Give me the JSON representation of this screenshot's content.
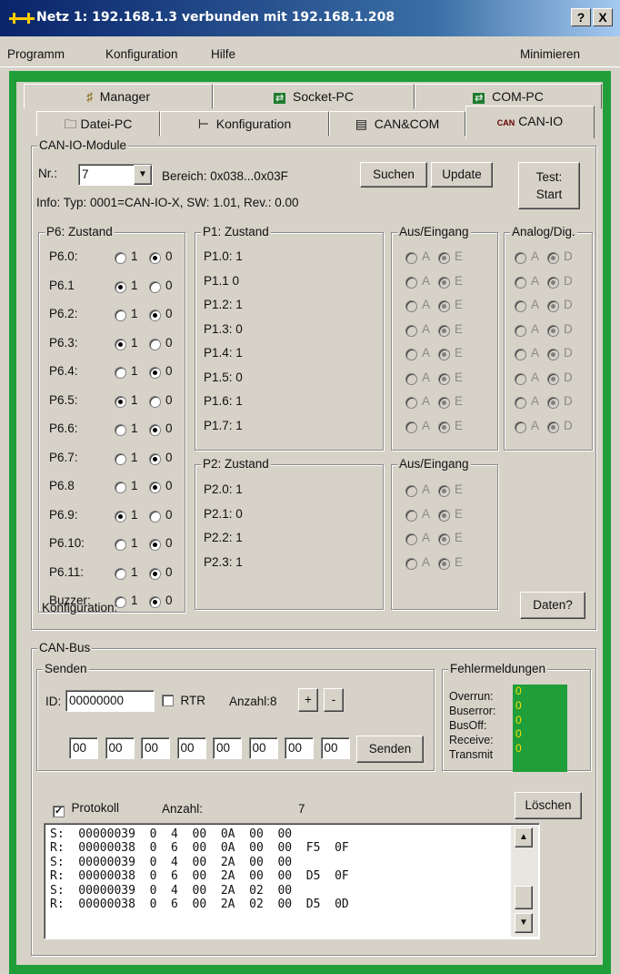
{
  "window": {
    "title": "Netz 1: 192.168.1.3  verbunden mit 192.168.1.208",
    "help_btn": "?",
    "close_btn": "X"
  },
  "menu": {
    "programm": "Programm",
    "konfiguration": "Konfiguration",
    "hilfe": "Hilfe",
    "minimieren": "Minimieren"
  },
  "tabs_row1": [
    "Manager",
    "Socket-PC",
    "COM-PC"
  ],
  "tabs_row2": [
    "Datei-PC",
    "Konfiguration",
    "CAN&COM",
    "CAN-IO"
  ],
  "tab_can_badge": "CAN",
  "module": {
    "group": "CAN-IO-Module",
    "nr_label": "Nr.:",
    "nr_value": "7",
    "bereich": "Bereich: 0x038...0x03F",
    "suchen": "Suchen",
    "update": "Update",
    "test1": "Test:",
    "test2": "Start",
    "info": "Info:  Typ: 0001=CAN-IO-X, SW: 1.01, Rev.: 0.00"
  },
  "p6": {
    "title": "P6: Zustand",
    "one": "1",
    "zero": "0",
    "rows": [
      {
        "name": "P6.0:",
        "state": 0
      },
      {
        "name": "P6.1",
        "state": 1
      },
      {
        "name": "P6.2:",
        "state": 0
      },
      {
        "name": "P6.3:",
        "state": 1
      },
      {
        "name": "P6.4:",
        "state": 0
      },
      {
        "name": "P6.5:",
        "state": 1
      },
      {
        "name": "P6.6:",
        "state": 0
      },
      {
        "name": "P6.7:",
        "state": 0
      },
      {
        "name": "P6.8",
        "state": 0
      },
      {
        "name": "P6.9:",
        "state": 1
      },
      {
        "name": "P6.10:",
        "state": 0
      },
      {
        "name": "P6.11:",
        "state": 0
      },
      {
        "name": "Buzzer:",
        "state": 0
      }
    ]
  },
  "p1": {
    "title": "P1: Zustand",
    "rows": [
      "P1.0:  1",
      "P1.1   0",
      "P1.2:  1",
      "P1.3:  0",
      "P1.4:  1",
      "P1.5:  0",
      "P1.6:  1",
      "P1.7:  1"
    ]
  },
  "p2": {
    "title": "P2: Zustand",
    "rows": [
      "P2.0:  1",
      "P2.1:  0",
      "P2.2:  1",
      "P2.3:  1"
    ]
  },
  "ausein": {
    "title": "Aus/Eingang",
    "a": "A",
    "e": "E"
  },
  "analog": {
    "title": "Analog/Dig.",
    "a": "A",
    "d": "D"
  },
  "konfig": {
    "label": "Konfiguration:",
    "daten": "Daten?"
  },
  "canbus": {
    "group": "CAN-Bus",
    "senden_group": "Senden",
    "id_label": "ID:",
    "id_value": "00000000",
    "rtr": "RTR",
    "anzahl": "Anzahl:8",
    "plus": "+",
    "minus": "-",
    "bytes": [
      "00",
      "00",
      "00",
      "00",
      "00",
      "00",
      "00",
      "00"
    ],
    "senden_btn": "Senden"
  },
  "fehler": {
    "title": "Fehlermeldungen",
    "labels": [
      "Overrun:",
      "Buserror:",
      "BusOff:",
      "Receive:",
      "Transmit"
    ],
    "values": [
      "0",
      "0",
      "0",
      "0",
      "0"
    ]
  },
  "protokoll": {
    "label": "Protokoll",
    "checked": "✓",
    "anzahl_label": "Anzahl:",
    "anzahl_value": "7",
    "loeschen": "Löschen",
    "lines": [
      "S:  00000039  0  4  00  0A  00  00",
      "R:  00000038  0  6  00  0A  00  00  F5  0F",
      "S:  00000039  0  4  00  2A  00  00",
      "R:  00000038  0  6  00  2A  00  00  D5  0F",
      "S:  00000039  0  4  00  2A  02  00",
      "R:  00000038  0  6  00  2A  02  00  D5  0D"
    ]
  }
}
